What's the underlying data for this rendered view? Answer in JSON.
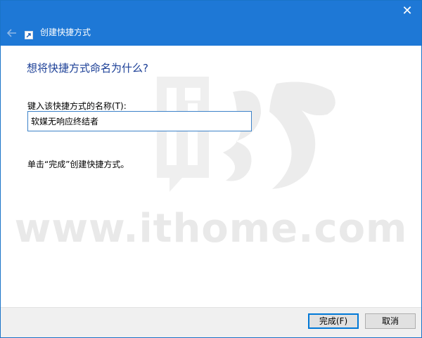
{
  "window": {
    "title": "创建快捷方式",
    "close_glyph": "✕"
  },
  "content": {
    "heading": "想将快捷方式命名为什么?",
    "field_label": "键入该快捷方式的名称(T):",
    "name_value": "软媒无响应终结者",
    "hint": "单击“完成”创建快捷方式。"
  },
  "watermark": {
    "text": "www.ithome.com"
  },
  "footer": {
    "finish_label": "完成(F)",
    "cancel_label": "取消"
  },
  "icons": {
    "back": "back-arrow-icon",
    "close": "close-icon",
    "app": "shortcut-icon"
  },
  "colors": {
    "header": "#1e78d6",
    "heading_text": "#1a3e96",
    "input_border": "#3c82c8",
    "primary_button_border": "#0078d7"
  }
}
